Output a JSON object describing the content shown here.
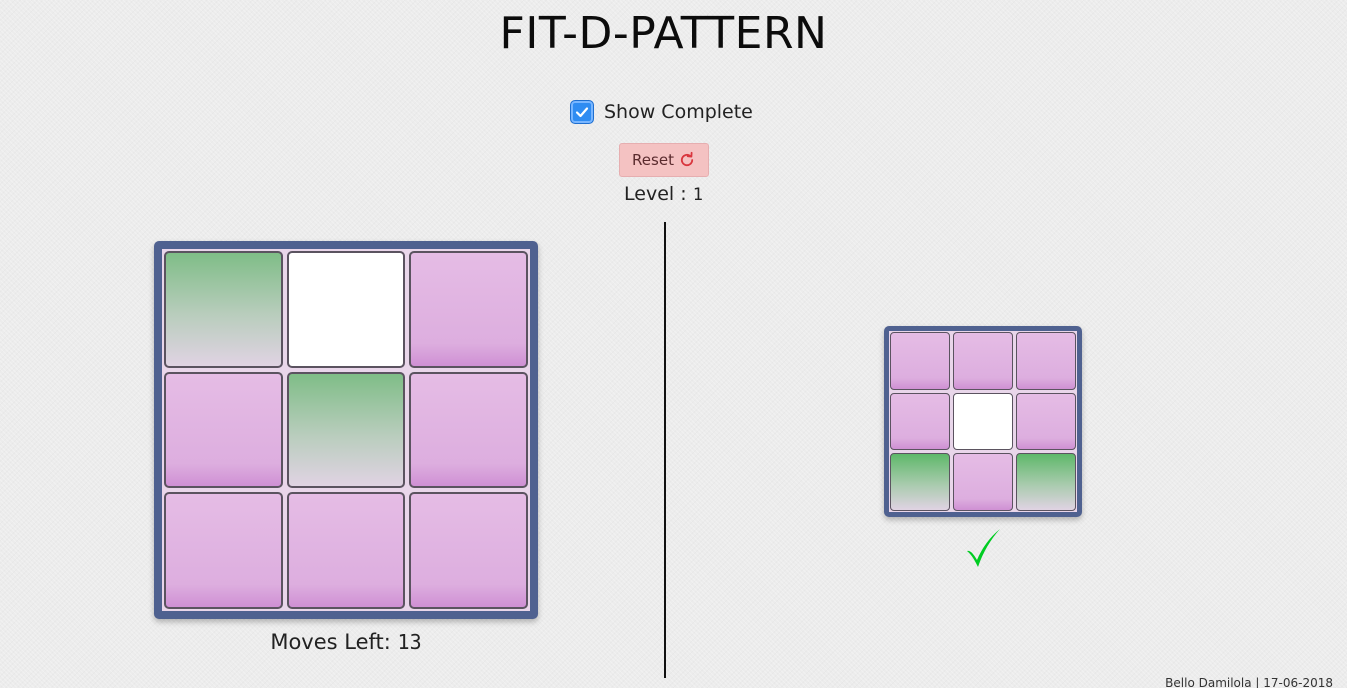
{
  "title": "FIT-D-PATTERN",
  "show_complete": {
    "label": "Show Complete",
    "checked": true
  },
  "reset": {
    "label": "Reset",
    "icon": "refresh-icon"
  },
  "level": {
    "label": "Level : ",
    "value": "1"
  },
  "main_board": {
    "tiles": [
      "green",
      "white",
      "pink",
      "pink",
      "green",
      "pink",
      "pink",
      "pink",
      "pink"
    ]
  },
  "target_board": {
    "tiles": [
      "pink",
      "pink",
      "pink",
      "pink",
      "white",
      "pink",
      "green",
      "pink",
      "green"
    ]
  },
  "moves": {
    "label": "Moves Left: ",
    "value": "13"
  },
  "footer": "Bello Damilola | 17-06-2018",
  "colors": {
    "board_frame": "#4f6190",
    "tile_pink": "#ddaedf",
    "tile_green": "#7fbd87",
    "reset_bg": "#f4c2c2",
    "checkbox": "#2f8cf2",
    "check_mark": "#00cc22"
  }
}
